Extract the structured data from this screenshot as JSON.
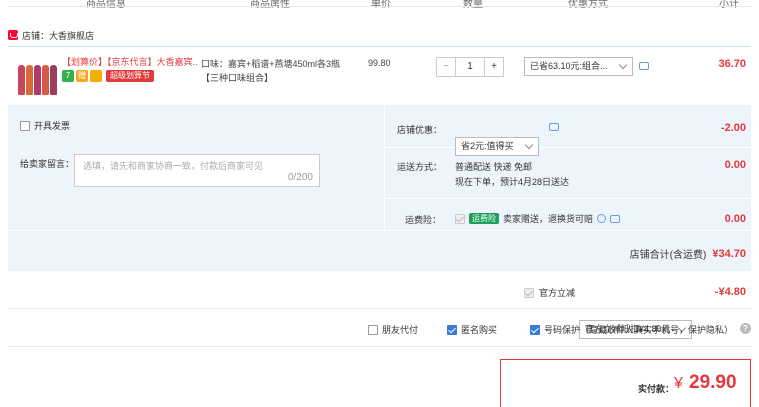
{
  "columns": {
    "info": "商品信息",
    "attr": "商品属性",
    "price": "单价",
    "qty": "数量",
    "promo": "优惠方式",
    "subtotal": "小计"
  },
  "shop": {
    "label": "店铺：大香旗舰店"
  },
  "item": {
    "title_tag": "【划算价】【京东代言】大香嘉宾...",
    "attr": "口味：嘉宾+稻谱+燕塘450ml各3瓶【三种口味组合】",
    "price": "99.80",
    "quantity": "1",
    "minus": "−",
    "plus": "+",
    "promo_select": "已省63.10元:组合...",
    "subtotal": "36.70",
    "badge_1": "7",
    "badge_2": "赠",
    "badge_promo": "超级划算节"
  },
  "options": {
    "invoice_label": "开具发票",
    "message_label": "给卖家留言：",
    "message_placeholder": "选填，请先和商家协商一致，付款后商家可见",
    "message_counter": "0/200",
    "shop_discount_label": "店铺优惠：",
    "shop_discount_select": "省2元:值得买",
    "shop_discount_amount": "-2.00",
    "shipping_label": "运送方式：",
    "shipping_line1": "普通配送 快递 免邮",
    "shipping_line2": "现在下单，预计4月28日送达",
    "shipping_amount": "0.00",
    "insurance_label": "运费险：",
    "insurance_tag": "运费险",
    "insurance_text": "卖家赠送，退换货可赔",
    "insurance_amount": "0.00"
  },
  "shop_total": {
    "label": "店铺合计(含运费)",
    "amount": "¥34.70"
  },
  "official": {
    "label": "官方立减",
    "select": "官方立减抵扣¥4.80元",
    "amount": "-¥4.80"
  },
  "bottom_options": {
    "friend_pay": "朋友代付",
    "anonymous": "匿名购买",
    "privacy": "号码保护（隐藏收件人真实手机号，保护隐私）",
    "help": "?"
  },
  "payment": {
    "label": "实付款：",
    "currency": "¥",
    "amount": "29.90"
  },
  "colors": {
    "accent": "#e4393c",
    "panel": "#eef4fb",
    "check": "#3a7ad9",
    "green": "#1aa05a"
  }
}
